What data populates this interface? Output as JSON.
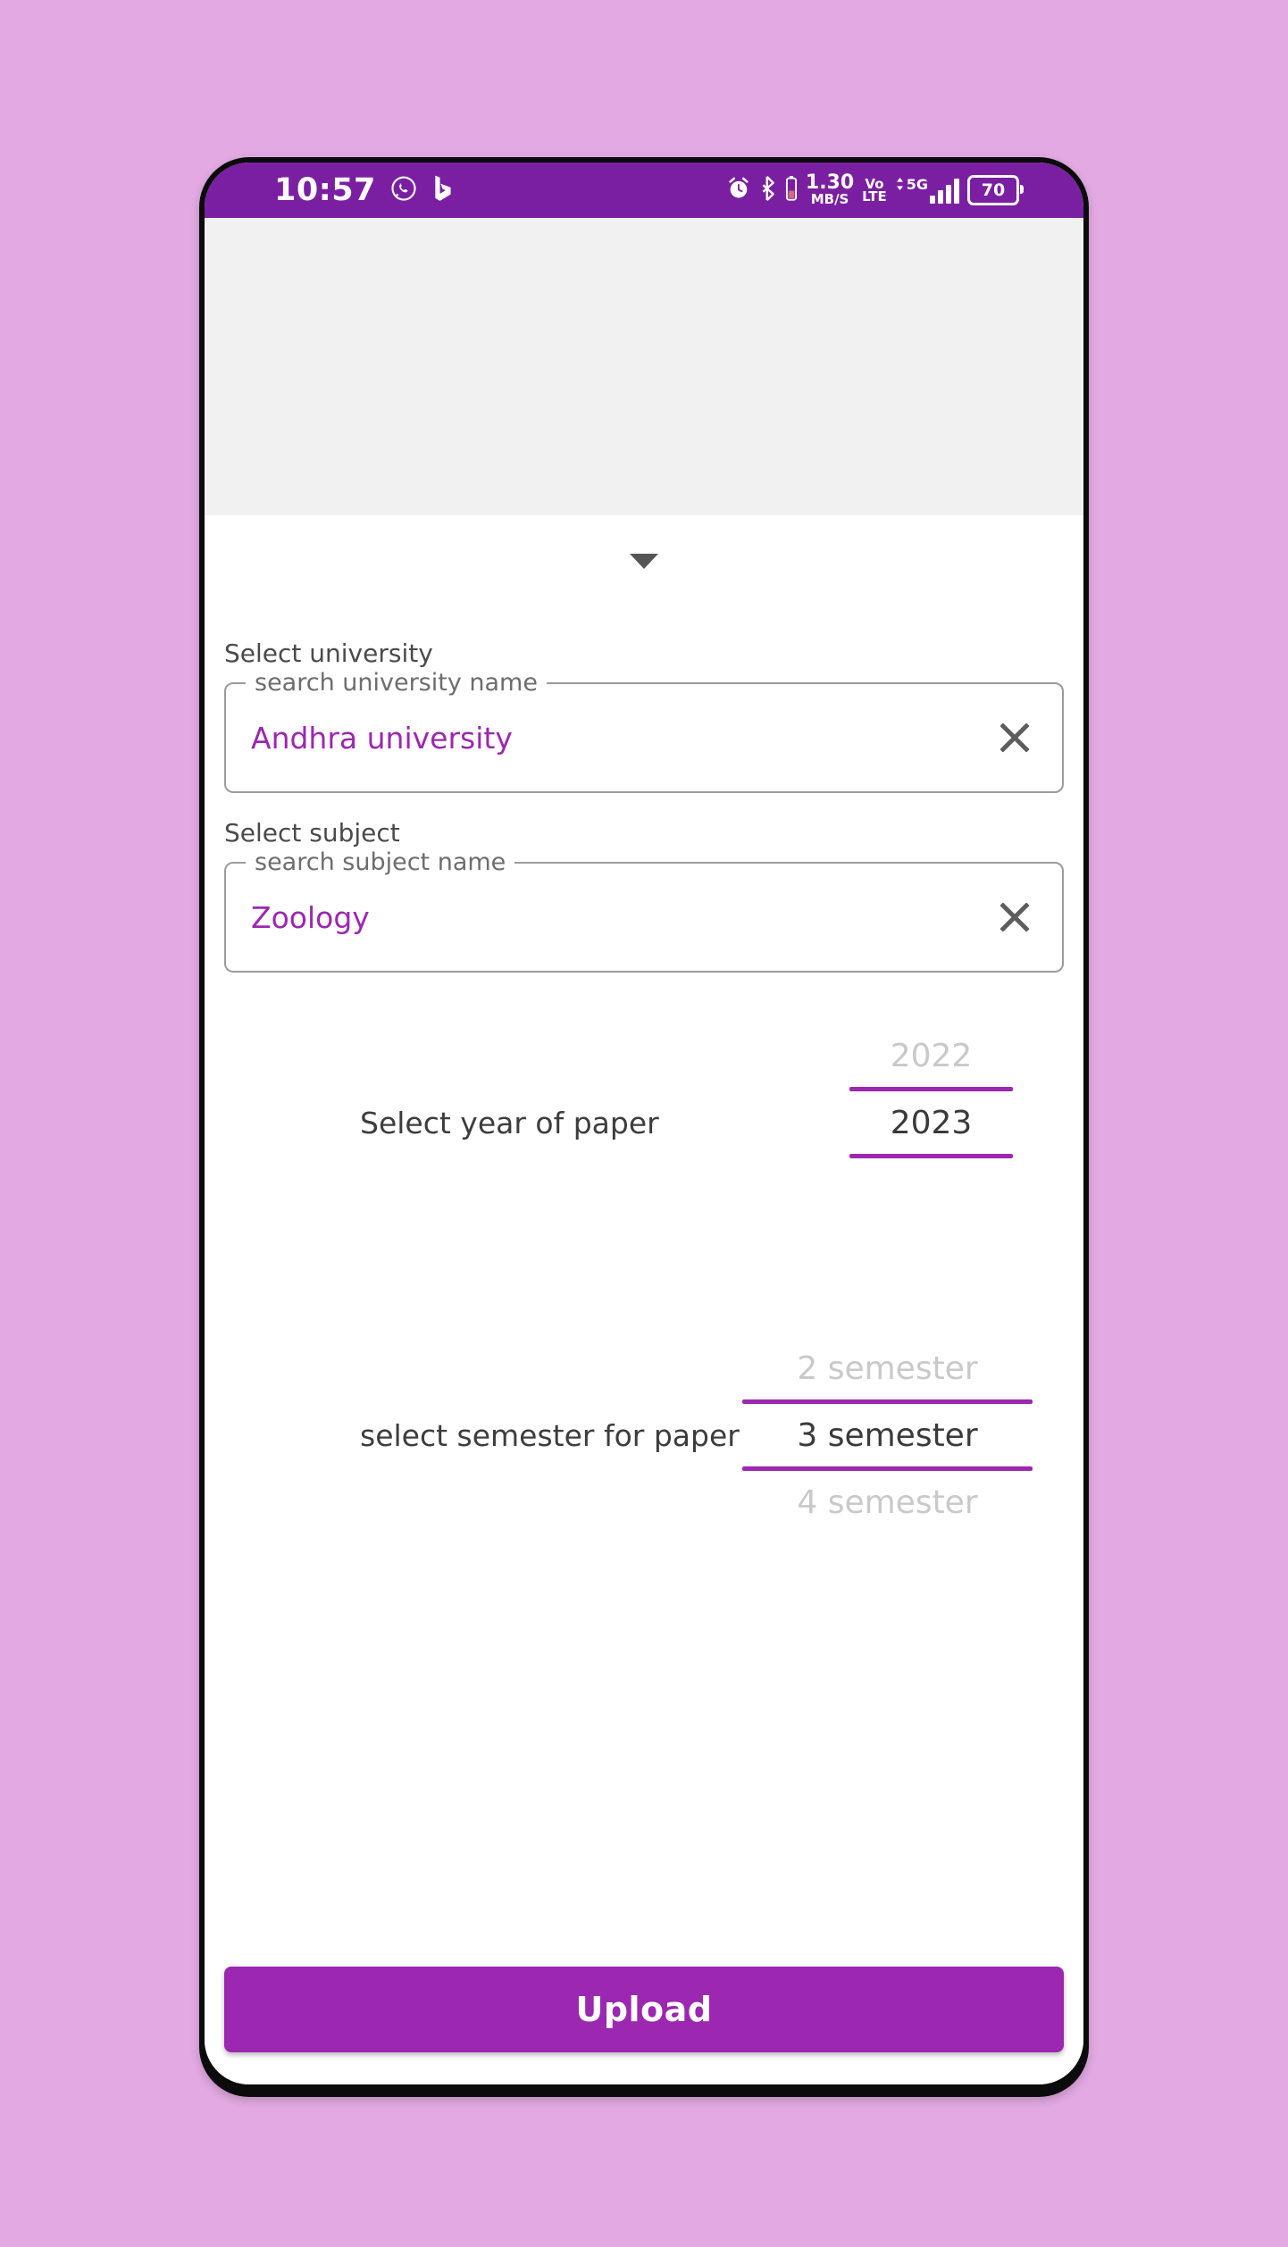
{
  "theme": {
    "page_background": "#e2a9e2",
    "status_bar": "#7b1fa2",
    "accent": "#9c27b0",
    "placeholder_area": "#f1f1f1"
  },
  "status_bar": {
    "time": "10:57",
    "left_icons": [
      "whatsapp-icon",
      "bing-icon"
    ],
    "alarm_icon": "alarm-clock-icon",
    "bluetooth_icon": "bluetooth-icon",
    "bluetooth_battery_icon": "bluetooth-battery-icon",
    "network_speed_value": "1.30",
    "network_speed_unit": "MB/S",
    "volte_line1": "Vo",
    "volte_line2": "LTE",
    "network_generation": "5G",
    "signal_icon": "signal-bars-icon",
    "battery_percent": "70"
  },
  "app": {
    "dropdown_caret": "chevron-down-icon",
    "university": {
      "heading": "Select university",
      "field_label": "search university name",
      "value": "Andhra university",
      "clear_icon": "close-icon"
    },
    "subject": {
      "heading": "Select subject",
      "field_label": "search subject name",
      "value": "Zoology",
      "clear_icon": "close-icon"
    },
    "year_picker": {
      "label": "Select year of paper",
      "above": "2022",
      "selected": "2023",
      "below": ""
    },
    "semester_picker": {
      "label": "select semester for paper",
      "above": "2 semester",
      "selected": "3 semester",
      "below": "4 semester"
    },
    "upload_button": "Upload"
  }
}
